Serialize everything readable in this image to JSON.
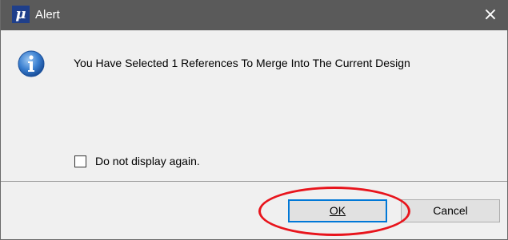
{
  "window": {
    "title": "Alert",
    "app_icon_glyph": "μ",
    "close_glyph": "×"
  },
  "message": "You Have Selected 1 References To Merge Into The Current Design",
  "checkbox": {
    "label": "Do not display again.",
    "checked": false
  },
  "buttons": {
    "ok_label": "OK",
    "cancel_label": "Cancel"
  },
  "colors": {
    "titlebar": "#5a5a5a",
    "info_icon": "#1f5fb8",
    "highlight_ellipse": "#e8141c",
    "ok_border": "#0078d7"
  }
}
